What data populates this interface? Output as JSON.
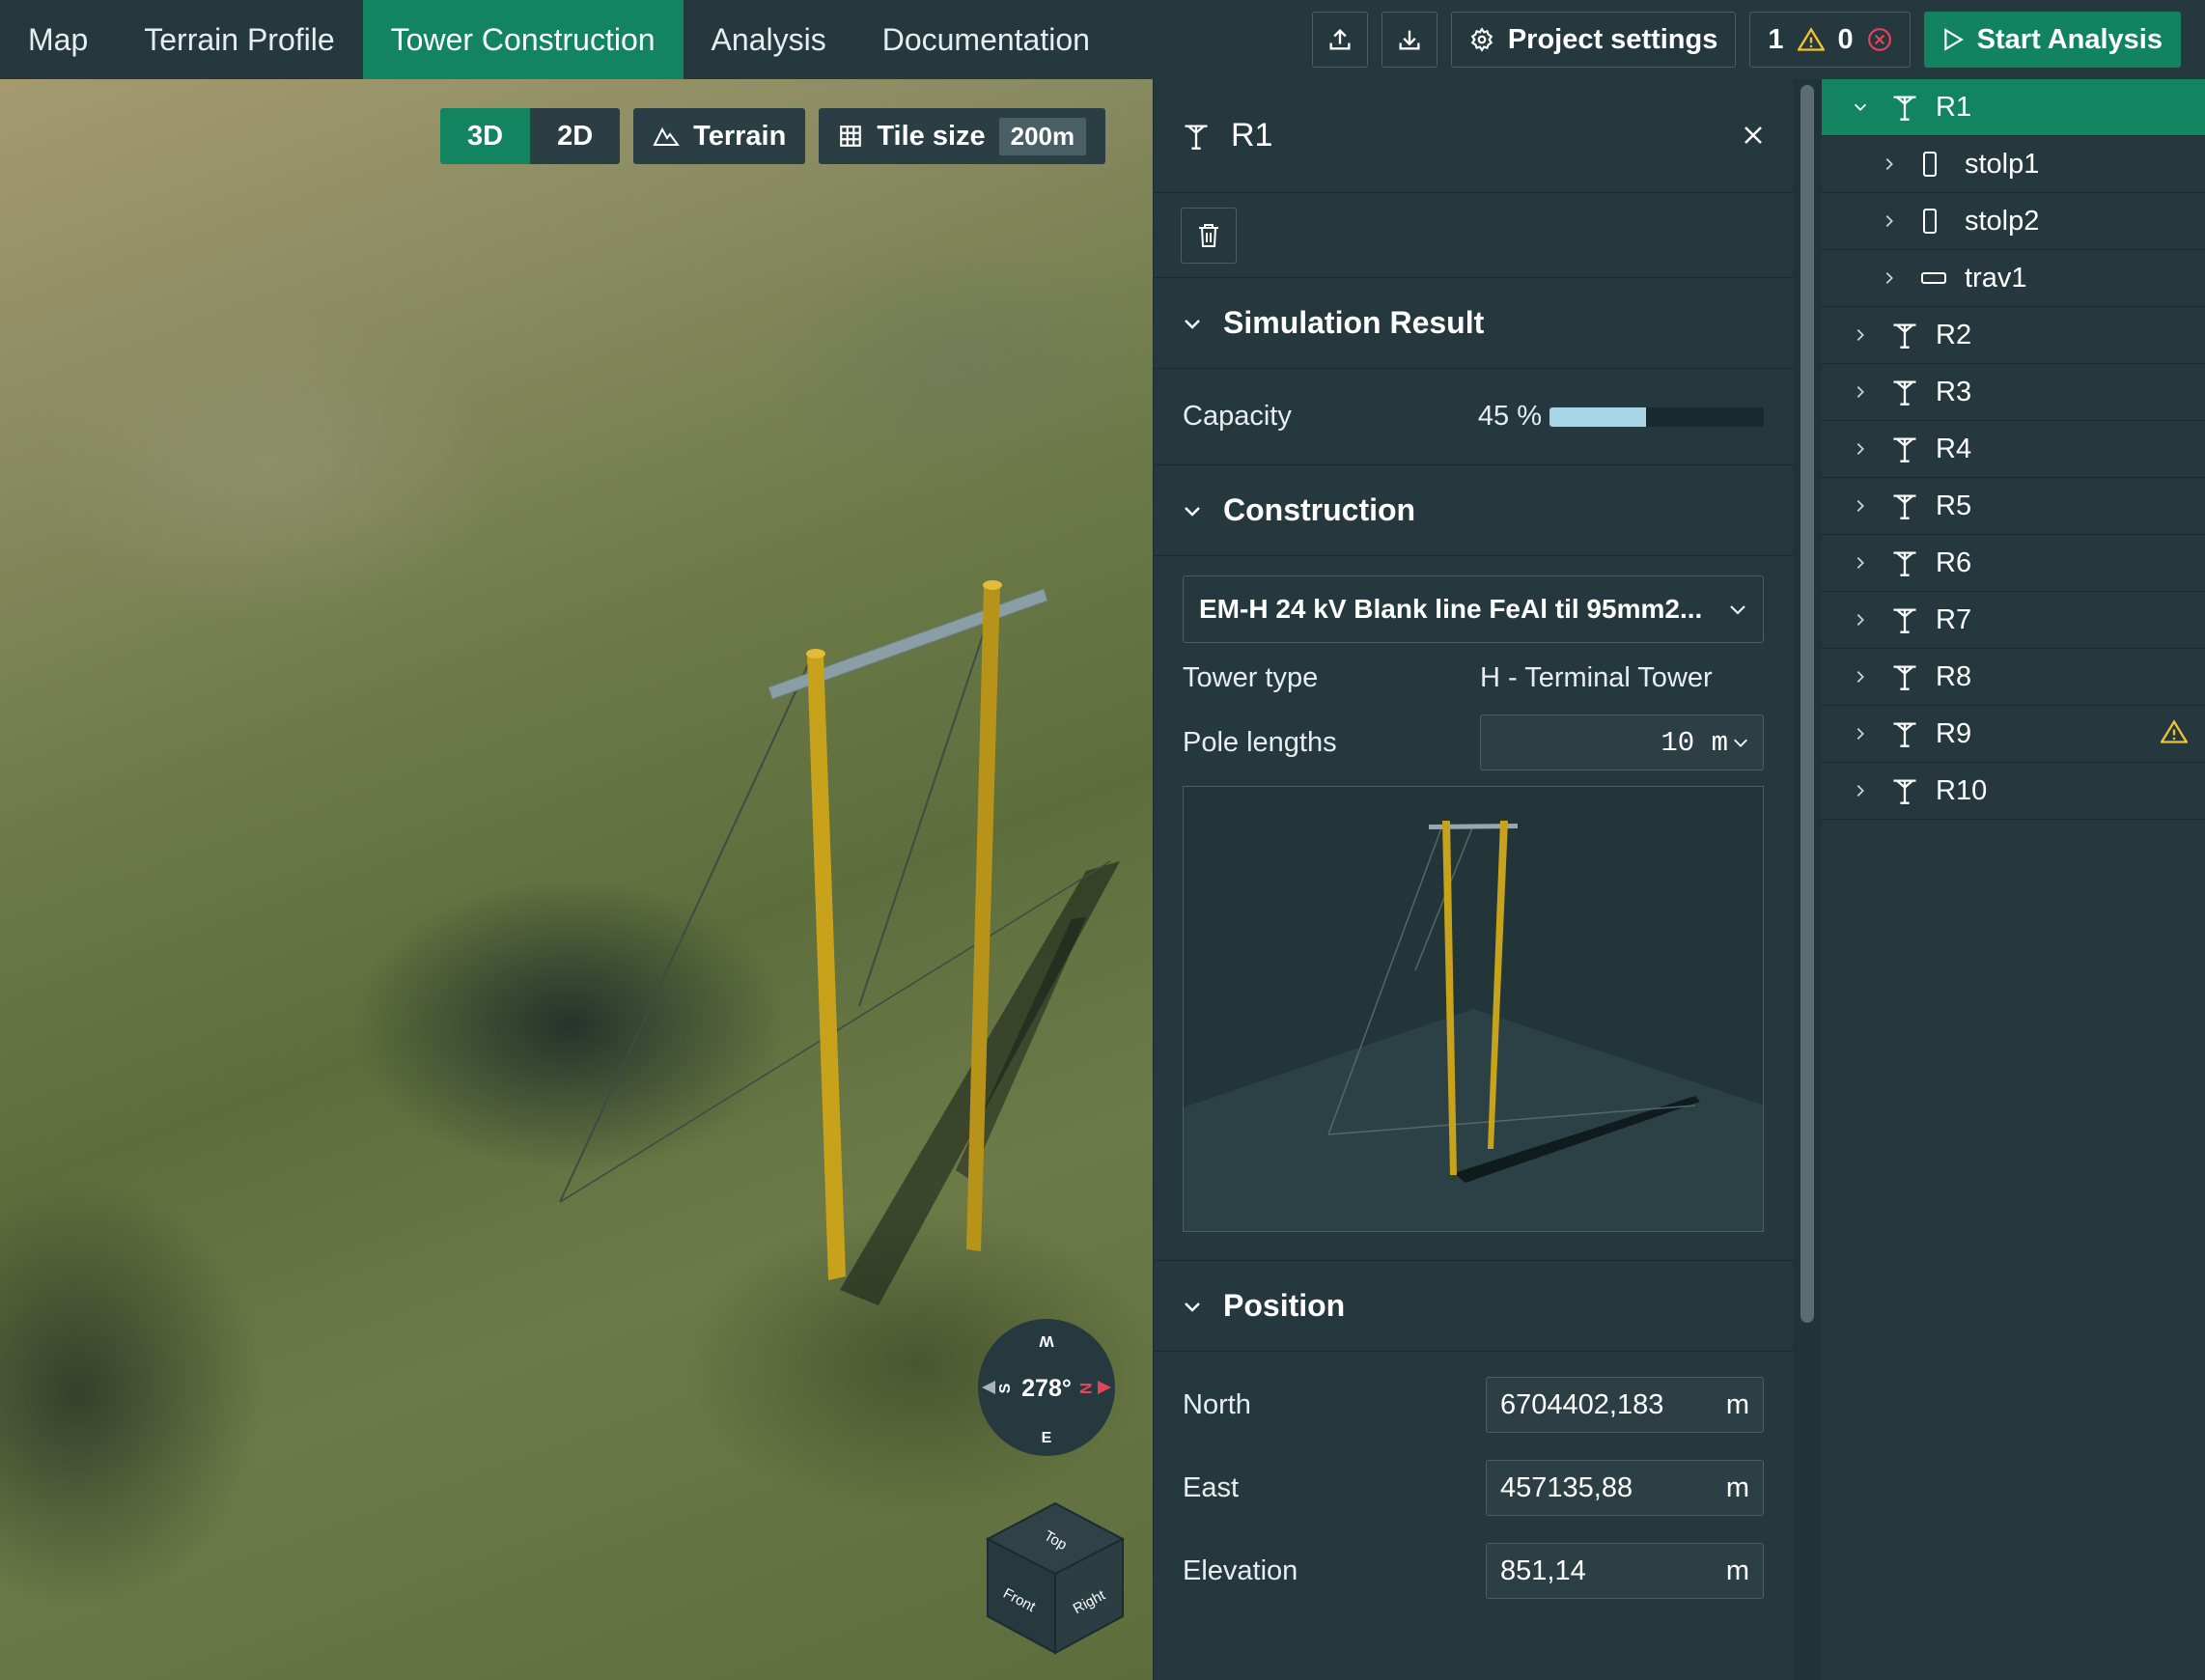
{
  "nav": {
    "tabs": [
      {
        "label": "Map"
      },
      {
        "label": "Terrain Profile"
      },
      {
        "label": "Tower Construction"
      },
      {
        "label": "Analysis"
      },
      {
        "label": "Documentation"
      }
    ],
    "project_settings": "Project settings",
    "warnings": "1",
    "errors": "0",
    "start_analysis": "Start Analysis"
  },
  "viewport": {
    "mode_3d": "3D",
    "mode_2d": "2D",
    "terrain": "Terrain",
    "tile_size_label": "Tile size",
    "tile_size_value": "200m",
    "compass": {
      "heading": "278°",
      "n": "N",
      "s": "S",
      "e": "E",
      "w": "W"
    },
    "cube": {
      "top": "Top",
      "front": "Front",
      "right": "Right"
    }
  },
  "panel": {
    "title": "R1",
    "simulation_result": "Simulation Result",
    "capacity_label": "Capacity",
    "capacity_value": "45 %",
    "capacity_fraction": 0.45,
    "construction": "Construction",
    "construction_select": "EM-H 24 kV Blank line FeAl til 95mm2...",
    "tower_type_label": "Tower type",
    "tower_type_value": "H - Terminal Tower",
    "pole_lengths_label": "Pole lengths",
    "pole_lengths_value": "10 m",
    "position": "Position",
    "north_label": "North",
    "north_value": "6704402,183",
    "east_label": "East",
    "east_value": "457135,88",
    "elevation_label": "Elevation",
    "elevation_value": "851,14",
    "unit": "m"
  },
  "tree": {
    "items": [
      {
        "label": "R1"
      },
      {
        "label": "stolp1"
      },
      {
        "label": "stolp2"
      },
      {
        "label": "trav1"
      },
      {
        "label": "R2"
      },
      {
        "label": "R3"
      },
      {
        "label": "R4"
      },
      {
        "label": "R5"
      },
      {
        "label": "R6"
      },
      {
        "label": "R7"
      },
      {
        "label": "R8"
      },
      {
        "label": "R9"
      },
      {
        "label": "R10"
      }
    ]
  },
  "colors": {
    "accent": "#128560",
    "panel": "#24383d",
    "capacity_fill": "#a9d3e6",
    "pole": "#c9a21b",
    "warning": "#f1c232",
    "error": "#e2445c"
  },
  "icons": [
    "upload-icon",
    "download-icon",
    "gear-icon",
    "warning-icon",
    "error-icon",
    "play-icon",
    "terrain-icon",
    "grid-icon",
    "tower-icon",
    "close-icon",
    "trash-icon",
    "chevron-down-icon",
    "pole-icon",
    "crossarm-icon",
    "chevron-right-icon"
  ]
}
